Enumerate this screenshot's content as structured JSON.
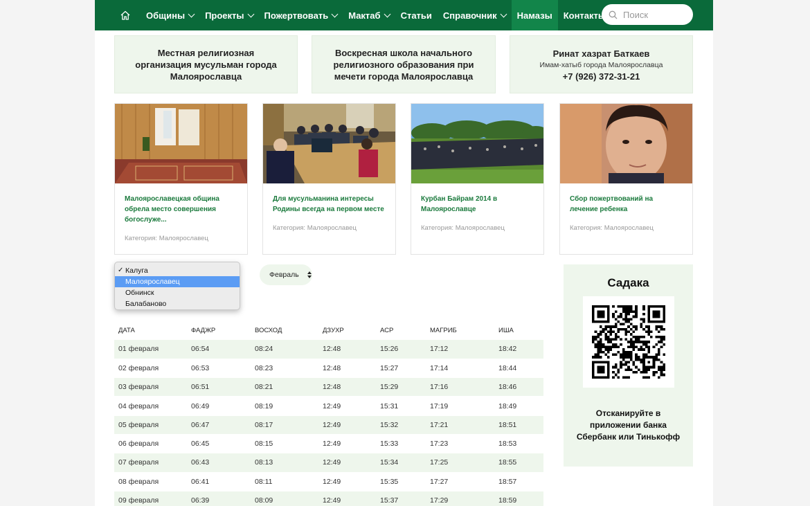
{
  "nav": {
    "items": [
      {
        "label": "Общины",
        "dropdown": true
      },
      {
        "label": "Проекты",
        "dropdown": true
      },
      {
        "label": "Пожертвовать",
        "dropdown": true
      },
      {
        "label": "Мактаб",
        "dropdown": true
      },
      {
        "label": "Статьи",
        "dropdown": false
      },
      {
        "label": "Справочник",
        "dropdown": true
      },
      {
        "label": "Намазы",
        "dropdown": false,
        "active": true
      },
      {
        "label": "Контакты",
        "dropdown": false
      }
    ],
    "search_placeholder": "Поиск",
    "color": "#0a6a3a"
  },
  "info": {
    "box1": "Местная религиозная организация мусульман города Малоярославца",
    "box2": "Воскресная школа начального религиозного образования при мечети города Малоярославца",
    "box3_name": "Ринат хазрат Баткаев",
    "box3_role": "Имам-хатыб города Малоярославца",
    "box3_phone": "+7 (926) 372-31-21"
  },
  "cards": [
    {
      "title": "Малоярославецкая община обрела место совершения богослуже...",
      "category": "Категория: Малоярославец"
    },
    {
      "title": "Для мусульманина интересы Родины всегда на первом месте",
      "category": "Категория: Малоярославец"
    },
    {
      "title": "Курбан Байрам 2014 в Малоярославце",
      "category": "Категория: Малоярославец"
    },
    {
      "title": "Сбор пожертвований на лечение ребенка",
      "category": "Категория: Малоярославец"
    }
  ],
  "city_dropdown": {
    "check": "✓",
    "options": [
      "Калуга",
      "Малоярославец",
      "Обнинск",
      "Балабаново"
    ],
    "checked": "Калуга",
    "highlighted": "Малоярославец"
  },
  "month_select": {
    "value": "Февраль"
  },
  "prayer_table": {
    "headers": [
      "ДАТА",
      "ФАДЖР",
      "ВОСХОД",
      "ДЗУХР",
      "АСР",
      "МАГРИБ",
      "ИША"
    ],
    "rows": [
      [
        "01 февраля",
        "06:54",
        "08:24",
        "12:48",
        "15:26",
        "17:12",
        "18:42"
      ],
      [
        "02 февраля",
        "06:53",
        "08:23",
        "12:48",
        "15:27",
        "17:14",
        "18:44"
      ],
      [
        "03 февраля",
        "06:51",
        "08:21",
        "12:48",
        "15:29",
        "17:16",
        "18:46"
      ],
      [
        "04 февраля",
        "06:49",
        "08:19",
        "12:49",
        "15:31",
        "17:19",
        "18:49"
      ],
      [
        "05 февраля",
        "06:47",
        "08:17",
        "12:49",
        "15:32",
        "17:21",
        "18:51"
      ],
      [
        "06 февраля",
        "06:45",
        "08:15",
        "12:49",
        "15:33",
        "17:23",
        "18:53"
      ],
      [
        "07 февраля",
        "06:43",
        "08:13",
        "12:49",
        "15:34",
        "17:25",
        "18:55"
      ],
      [
        "08 февраля",
        "06:41",
        "08:11",
        "12:49",
        "15:35",
        "17:27",
        "18:57"
      ],
      [
        "09 февраля",
        "06:39",
        "08:09",
        "12:49",
        "15:37",
        "17:29",
        "18:59"
      ]
    ]
  },
  "sadaka": {
    "title": "Садака",
    "text": "Отсканируйте в приложении банка Сбербанк или Тинькофф"
  }
}
